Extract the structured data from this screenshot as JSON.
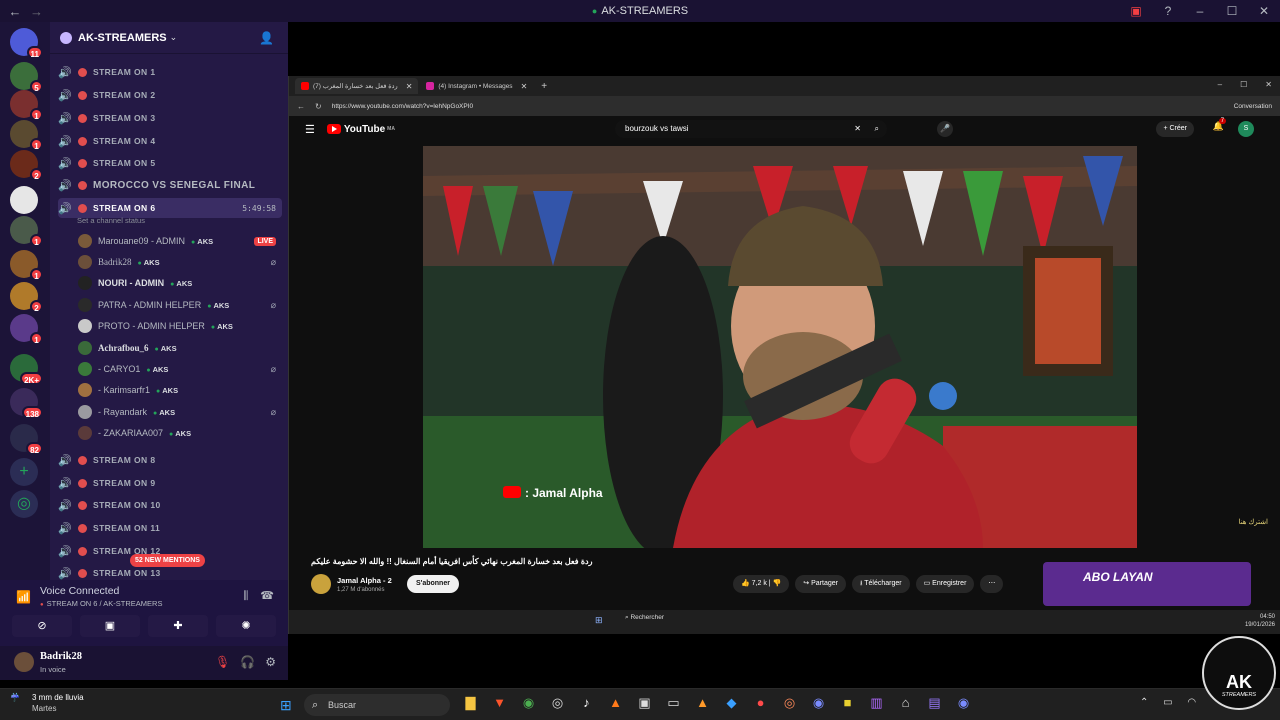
{
  "window": {
    "title": "AK-STREAMERS"
  },
  "rail": {
    "badges": [
      "11",
      "5",
      "1",
      "1",
      "2",
      "1",
      "1",
      "2",
      "1",
      "1",
      "1",
      "2K+",
      "138",
      "82"
    ]
  },
  "server": {
    "name": "AK-STREAMERS"
  },
  "channels": [
    {
      "label": "STREAM ON 1"
    },
    {
      "label": "STREAM ON 2"
    },
    {
      "label": "STREAM ON 3"
    },
    {
      "label": "STREAM ON 4"
    },
    {
      "label": "STREAM ON 5"
    },
    {
      "label": "MOROCCO VS SENEGAL FINAL"
    },
    {
      "label": "STREAM ON 6",
      "timer": "5:49:58",
      "status": "Set a channel status"
    },
    {
      "label": "STREAM ON 8"
    },
    {
      "label": "STREAM ON 9"
    },
    {
      "label": "STREAM ON 10"
    },
    {
      "label": "STREAM ON 11"
    },
    {
      "label": "STREAM ON 12"
    },
    {
      "label": "STREAM ON 13"
    }
  ],
  "voice_users": [
    {
      "name": "Marouane09 - ADMIN",
      "tag": "AKS",
      "live": "LIVE"
    },
    {
      "name": "Badrik28",
      "tag": "AKS"
    },
    {
      "name": "NOURI - ADMIN",
      "tag": "AKS"
    },
    {
      "name": "PATRA - ADMIN HELPER",
      "tag": "AKS"
    },
    {
      "name": "PROTO - ADMIN HELPER",
      "tag": "AKS"
    },
    {
      "name": "Achrafbou_6",
      "tag": "AKS"
    },
    {
      "name": "- CARYO1",
      "tag": "AKS"
    },
    {
      "name": "- Karimsarfr1",
      "tag": "AKS"
    },
    {
      "name": "- Rayandark",
      "tag": "AKS"
    },
    {
      "name": "- ZAKARIAA007",
      "tag": "AKS"
    }
  ],
  "mentions": "52 NEW MENTIONS",
  "voice": {
    "title": "Voice Connected",
    "subtitle": "STREAM ON 6 / AK-STREAMERS"
  },
  "user": {
    "name": "Badrik28",
    "status": "In voice"
  },
  "browser": {
    "tab1": "ردة فعل بعد خسارة المغرب (7)",
    "tab2": "(4) Instagram • Messages",
    "url": "https://www.youtube.com/watch?v=lehNpGoXPI0",
    "conversation": "Conversation"
  },
  "youtube": {
    "logo": "YouTube",
    "region": "MA",
    "search": "bourzouk vs tawsi",
    "create": "Créer",
    "notif_count": "7",
    "avatar": "S",
    "credit": ": Jamal Alpha",
    "side_text": "اشترك هنا",
    "video_title": "ردة فعل بعد خسارة المغرب نهائي كأس افريقيا أمام السنغال !! والله الا حشومة عليكم",
    "channel": "Jamal Alpha - 2",
    "subscribers": "1,27 M d'abonnés",
    "subscribe": "S'abonner",
    "likes": "7,2 k",
    "share": "Partager",
    "download": "Télécharger",
    "save": "Enregistrer",
    "ad_text": "ABO LAYAN"
  },
  "inner_taskbar": {
    "search": "Rechercher",
    "time": "04:50",
    "date": "19/01/2026"
  },
  "taskbar": {
    "weather": "3 mm de lluvia",
    "day": "Martes",
    "search": "Buscar"
  },
  "logo": {
    "text": "AK",
    "subtext": "STREAMERS"
  }
}
